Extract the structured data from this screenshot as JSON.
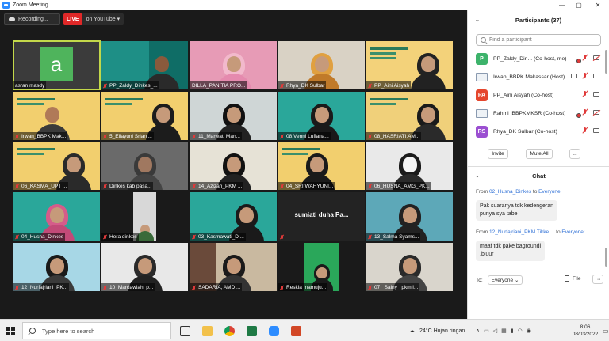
{
  "window": {
    "title": "Zoom Meeting",
    "minimize": "—",
    "maximize": "▢",
    "close": "✕"
  },
  "toolbar": {
    "recording_label": "Recording...",
    "live_badge": "LIVE",
    "live_target": "on YouTube ▾"
  },
  "gallery": {
    "tiles": [
      {
        "name": "asran masdy",
        "avatar_letter": "a"
      },
      {
        "name": "PP_Zaldy_Dinkes_..."
      },
      {
        "name": "DILLA_PANITIA PRO..."
      },
      {
        "name": "Rhya_DK Sulbar"
      },
      {
        "name": "PP_Aini Aisyah"
      },
      {
        "name": "Irwan_BBPK Mak..."
      },
      {
        "name": "5_Ellayuni Sriani..."
      },
      {
        "name": "11_Marwati Man..."
      },
      {
        "name": "08.Venni Lufiana..."
      },
      {
        "name": "08_HASRIATI.AM..."
      },
      {
        "name": "06_KASMA_UPT ..."
      },
      {
        "name": "Dinkes kab pasa..."
      },
      {
        "name": "14_Azizah_PKM ..."
      },
      {
        "name": "04_SRI WAHYUNI..."
      },
      {
        "name": "06_HUSNA_AMG_PK..."
      },
      {
        "name": "04_Husna_Dinkes"
      },
      {
        "name": "Hera dinkes"
      },
      {
        "name": "03_Kasmawati_Di..."
      },
      {
        "name": "sumiati duha Pa...",
        "no_video": true
      },
      {
        "name": "13_Salma Syams..."
      },
      {
        "name": "12_Nurfajriani_PK..."
      },
      {
        "name": "10_Mardawiah_p..."
      },
      {
        "name": "SADARIA, AMD ..."
      },
      {
        "name": "Reskia mamuju..."
      },
      {
        "name": "07_ Sainy _pkm l..."
      }
    ]
  },
  "participants": {
    "header": "Participants (37)",
    "search_placeholder": "Find a participant",
    "rows": [
      {
        "initials": "P",
        "color": "#3db36b",
        "name": "PP_Zaldy_Din... (Co-host, me)"
      },
      {
        "initials": "",
        "color": "",
        "name": "Irwan_BBPK Makassar (Host)"
      },
      {
        "initials": "PA",
        "color": "#e5462d",
        "name": "PP_Aini Aisyah (Co-host)"
      },
      {
        "initials": "",
        "color": "",
        "name": "Rahmi_BBPKMKSR (Co-host)"
      },
      {
        "initials": "RS",
        "color": "#9b4fd1",
        "name": "Rhya_DK Sulbar (Co-host)"
      }
    ],
    "invite_label": "Invite",
    "mute_all_label": "Mute All",
    "more_label": "..."
  },
  "chat": {
    "header": "Chat",
    "messages": [
      {
        "from_prefix": "From",
        "from": "02_Husna_Dinkes",
        "to_prefix": "to",
        "to": "Everyone:",
        "line1": "Pak suaranya tdk kedengeran",
        "line2": "punya sya  tabe"
      },
      {
        "from_prefix": "From",
        "from": "12_Nurfajriani_PKM Tikke ...",
        "to_prefix": "to",
        "to": "Everyone:",
        "line1": "maaf tdk pake bagroundl",
        "line2": ",bluur"
      }
    ],
    "to_label": "To:",
    "to_value": "Everyone ⌄",
    "file_label": "File",
    "more_label": "···"
  },
  "taskbar": {
    "search_placeholder": "Type here to search",
    "weather": "24°C  Hujan ringan",
    "time": "8:06",
    "date": "08/03/2022"
  }
}
